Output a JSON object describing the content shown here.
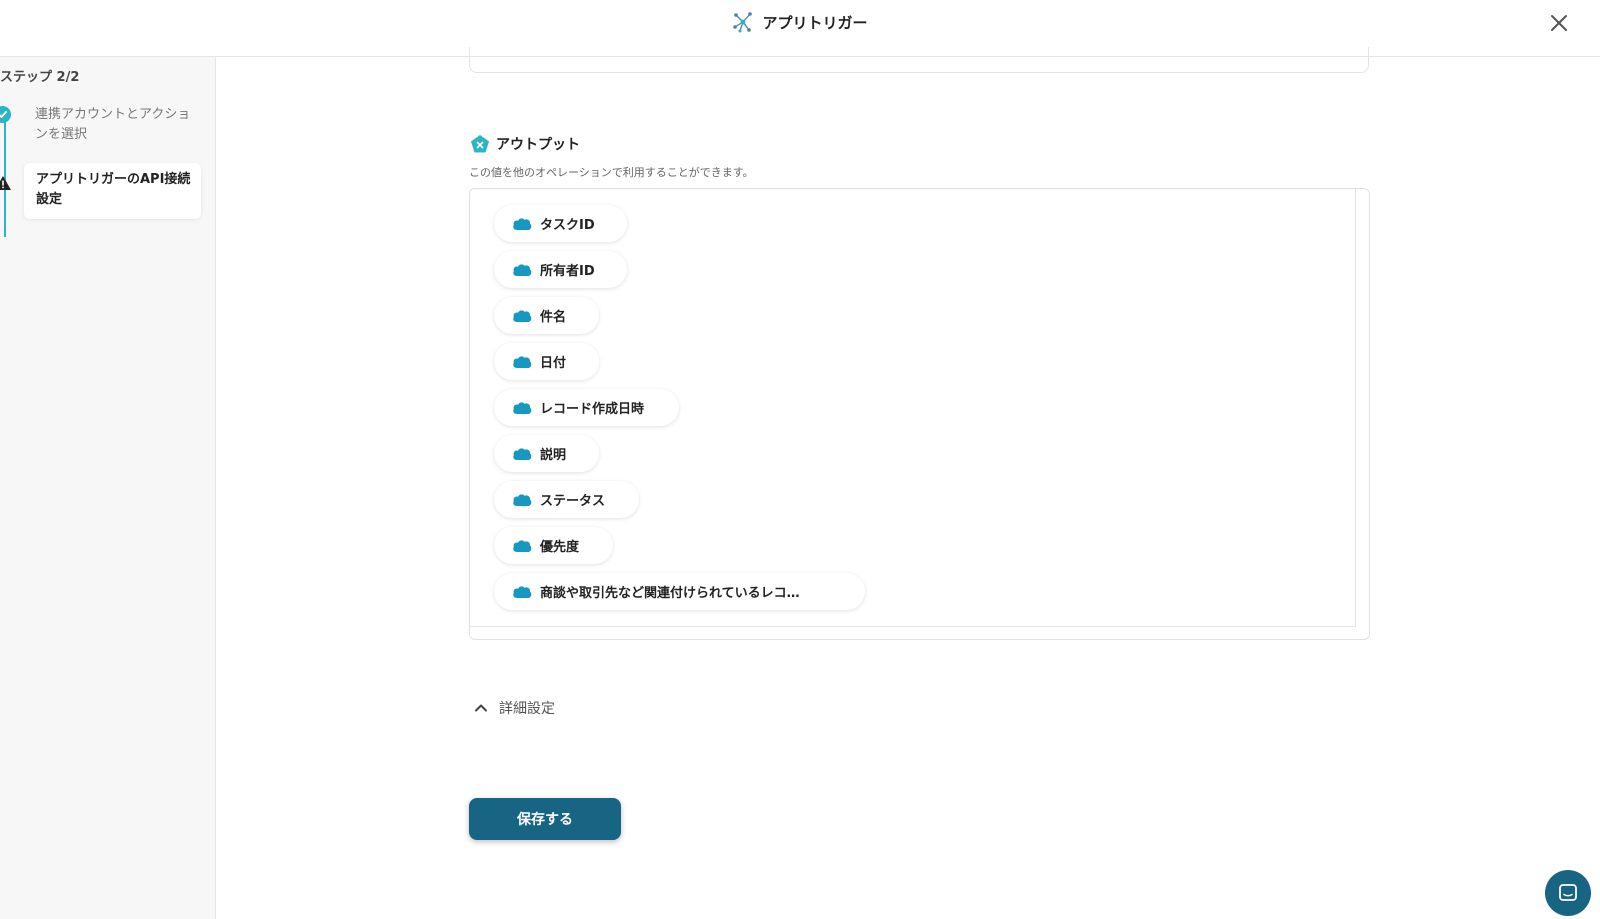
{
  "header": {
    "title": "アプリトリガー",
    "app_icon": "network-nodes-icon",
    "close_icon": "close-icon"
  },
  "sidebar": {
    "step_label": "ステップ 2/2",
    "steps": [
      {
        "label": "連携アカウントとアクションを選択",
        "status": "complete",
        "icon": "check-circle-icon"
      },
      {
        "label": "アプリトリガーのAPI接続設定",
        "status": "warning",
        "icon": "warning-icon",
        "active": true
      }
    ]
  },
  "output": {
    "title": "アウトプット",
    "icon": "output-pentagon-icon",
    "description": "この値を他のオペレーションで利用することができます。",
    "items": [
      {
        "label": "タスクID",
        "icon": "salesforce-cloud-icon"
      },
      {
        "label": "所有者ID",
        "icon": "salesforce-cloud-icon"
      },
      {
        "label": "件名",
        "icon": "salesforce-cloud-icon"
      },
      {
        "label": "日付",
        "icon": "salesforce-cloud-icon"
      },
      {
        "label": "レコード作成日時",
        "icon": "salesforce-cloud-icon"
      },
      {
        "label": "説明",
        "icon": "salesforce-cloud-icon"
      },
      {
        "label": "ステータス",
        "icon": "salesforce-cloud-icon"
      },
      {
        "label": "優先度",
        "icon": "salesforce-cloud-icon"
      },
      {
        "label": "商談や取引先など関連付けられているレコ…",
        "icon": "salesforce-cloud-icon"
      }
    ]
  },
  "advanced_settings": {
    "label": "詳細設定",
    "icon": "chevron-up-icon"
  },
  "save_button": {
    "label": "保存する"
  },
  "chat_widget": {
    "icon": "chat-bubble-icon"
  },
  "colors": {
    "accent": "#2bb3c8",
    "primary_button": "#176483",
    "salesforce_blue": "#1798c1"
  }
}
